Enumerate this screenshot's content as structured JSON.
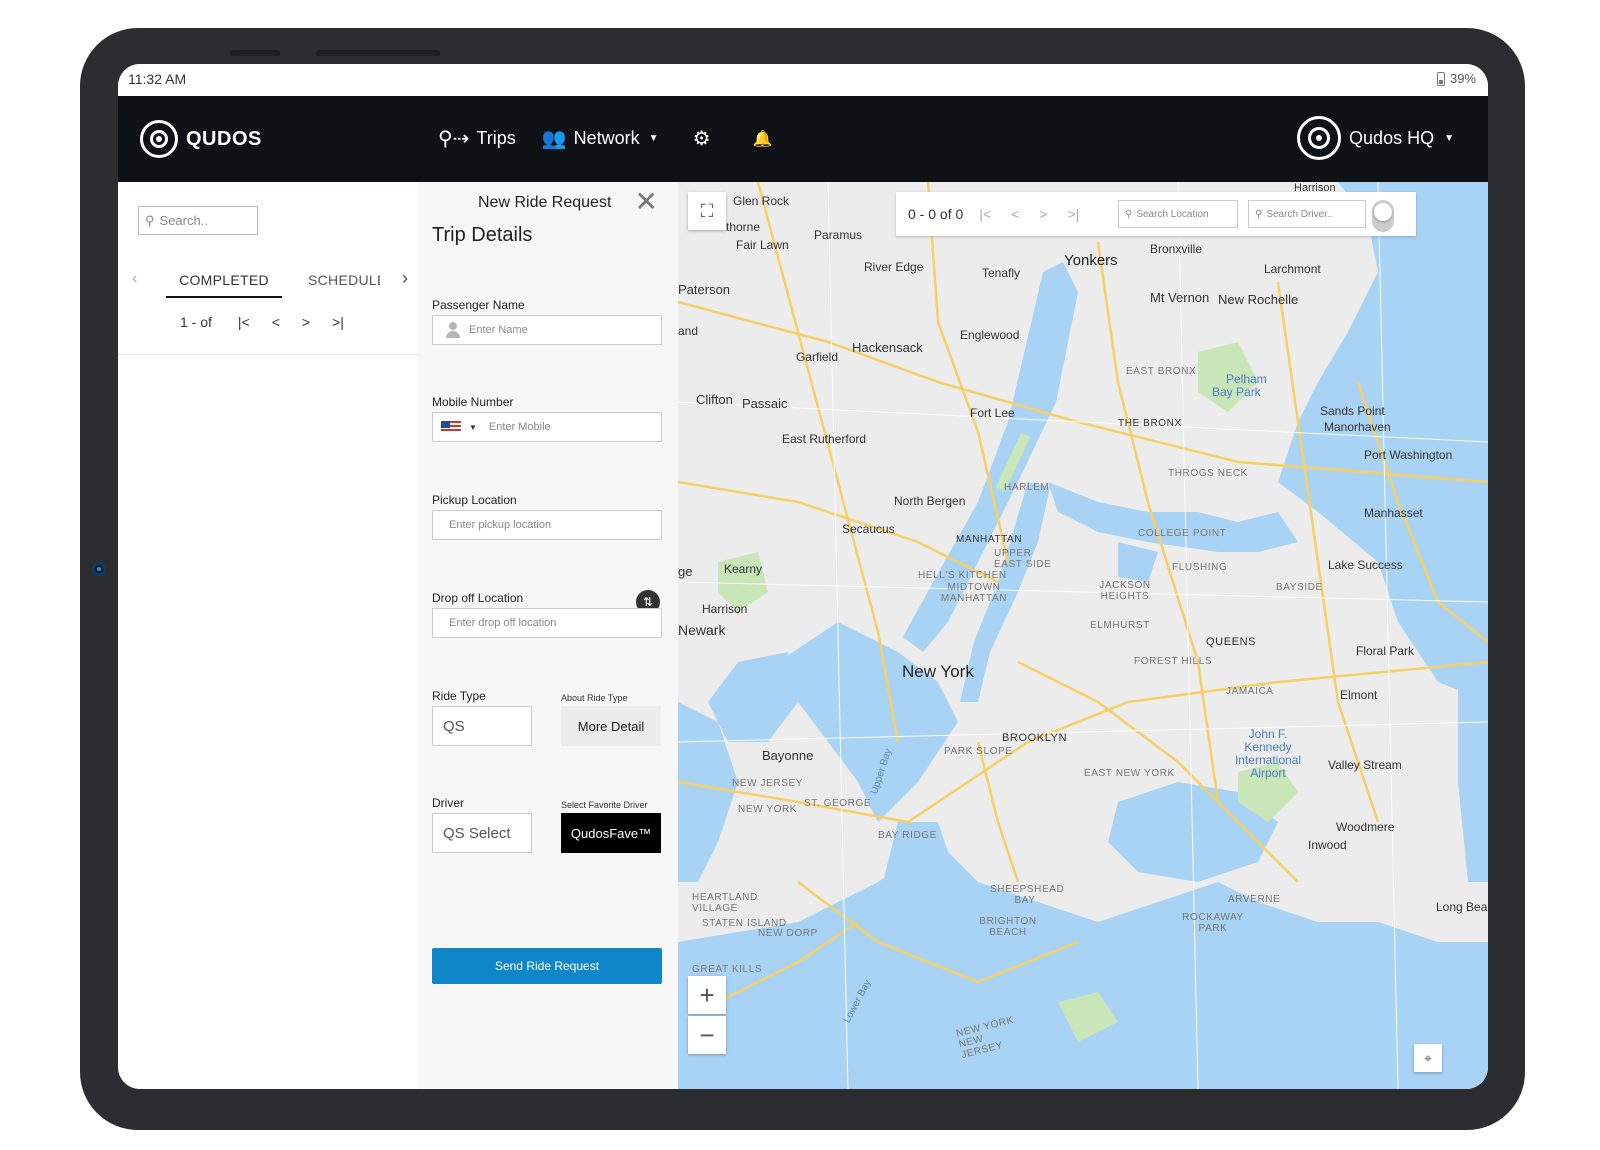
{
  "status_bar": {
    "time": "11:32 AM",
    "battery": "39%"
  },
  "nav": {
    "brand": "QUDOS",
    "items": [
      {
        "label": "Trips",
        "icon": "trips-icon"
      },
      {
        "label": "Network",
        "icon": "people-icon",
        "dropdown": true
      }
    ],
    "settings_icon": "gear-icon",
    "notifications_icon": "bell-icon",
    "account": "Qudos HQ"
  },
  "left_panel": {
    "search_placeholder": "Search..",
    "tabs": [
      "COMPLETED",
      "SCHEDULE"
    ],
    "active_tab": "COMPLETED",
    "pager": {
      "range": "1 - of",
      "first": "|<",
      "prev": "<",
      "next": ">",
      "last": ">|"
    }
  },
  "form": {
    "header": "New Ride Request",
    "section_title": "Trip Details",
    "passenger_name": {
      "label": "Passenger Name",
      "placeholder": "Enter Name"
    },
    "mobile": {
      "label": "Mobile Number",
      "placeholder": "Enter Mobile"
    },
    "pickup": {
      "label": "Pickup Location",
      "placeholder": "Enter pickup location"
    },
    "dropoff": {
      "label": "Drop off Location",
      "placeholder": "Enter drop off location"
    },
    "ride_type": {
      "label": "Ride Type",
      "value": "QS",
      "about_label": "About Ride Type",
      "button": "More Detail"
    },
    "driver": {
      "label": "Driver",
      "value": "QS Select",
      "fav_label": "Select Favorite Driver",
      "button": "QudosFave™"
    },
    "submit": "Send Ride Request"
  },
  "map": {
    "toolbar": {
      "count": "0 - 0 of 0",
      "first": "|<",
      "prev": "<",
      "next": ">",
      "last": ">|",
      "search_location": "Search Location",
      "search_driver": "Search Driver.."
    },
    "labels": {
      "glen_rock": "Glen Rock",
      "paramus": "Paramus",
      "harrison_top": "Harrison",
      "hawthorne": "thorne",
      "fair_lawn": "Fair Lawn",
      "river_edge": "River Edge",
      "tenafly": "Tenafly",
      "yonkers": "Yonkers",
      "bronxville": "Bronxville",
      "larchmont": "Larchmont",
      "paterson": "Paterson",
      "mt_vernon": "Mt Vernon",
      "new_rochelle": "New Rochelle",
      "englewood": "Englewood",
      "hackensack": "Hackensack",
      "garfield": "Garfield",
      "east_bronx": "EAST BRONX",
      "pelham": "Pelham",
      "bay_park": "Bay Park",
      "clifton": "Clifton",
      "passaic": "Passaic",
      "fort_lee": "Fort Lee",
      "sands_point": "Sands Point",
      "manorhaven": "Manorhaven",
      "the_bronx": "THE BRONX",
      "port_washington": "Port Washington",
      "east_rutherford": "East Rutherford",
      "throgs_neck": "THROGS NECK",
      "harlem": "HARLEM",
      "north_bergen": "North Bergen",
      "secaucus": "Secaucus",
      "manhasset": "Manhasset",
      "college_point": "COLLEGE POINT",
      "manhattan": "MANHATTAN",
      "upper_east_side": "UPPER EAST SIDE",
      "flushing": "FLUSHING",
      "lake_success": "Lake Success",
      "kearny": "Kearny",
      "hells_kitchen": "HELL'S KITCHEN",
      "midtown": "MIDTOWN MANHATTAN",
      "jackson_heights": "JACKSON HEIGHTS",
      "bayside": "BAYSIDE",
      "harrison": "Harrison",
      "newark": "Newark",
      "elmhurst": "ELMHURST",
      "queens": "QUEENS",
      "floral_park": "Floral Park",
      "forest_hills": "FOREST HILLS",
      "new_york": "New York",
      "jamaica": "JAMAICA",
      "elmont": "Elmont",
      "brooklyn": "BROOKLYN",
      "bayonne": "Bayonne",
      "park_slope": "PARK SLOPE",
      "jfk": "John F. Kennedy International Airport",
      "valley_stream": "Valley Stream",
      "east_new_york": "EAST NEW YORK",
      "new_jersey": "NEW JERSEY",
      "new_york_state": "NEW YORK",
      "st_george": "ST. GEORGE",
      "woodmere": "Woodmere",
      "inwood": "Inwood",
      "bay_ridge": "BAY RIDGE",
      "heartland_village": "HEARTLAND VILLAGE",
      "sheepshead_bay": "SHEEPSHEAD BAY",
      "arverne": "ARVERNE",
      "staten_island": "STATEN ISLAND",
      "brighton_beach": "BRIGHTON BEACH",
      "rockaway_park": "ROCKAWAY PARK",
      "long_beach": "Long Bea",
      "new_dorp": "NEW DORP",
      "great_kills": "GREAT KILLS",
      "new_york_nj": "NEW YORK NEW JERSEY",
      "upper_bay": "Upper Bay",
      "lower_bay": "Lower Bay",
      "edge_w": "ge",
      "and_w": "and"
    },
    "colors": {
      "water": "#a9d3f5",
      "land": "#ececec",
      "park": "#c8e6b8",
      "road": "#f6cf65"
    }
  }
}
